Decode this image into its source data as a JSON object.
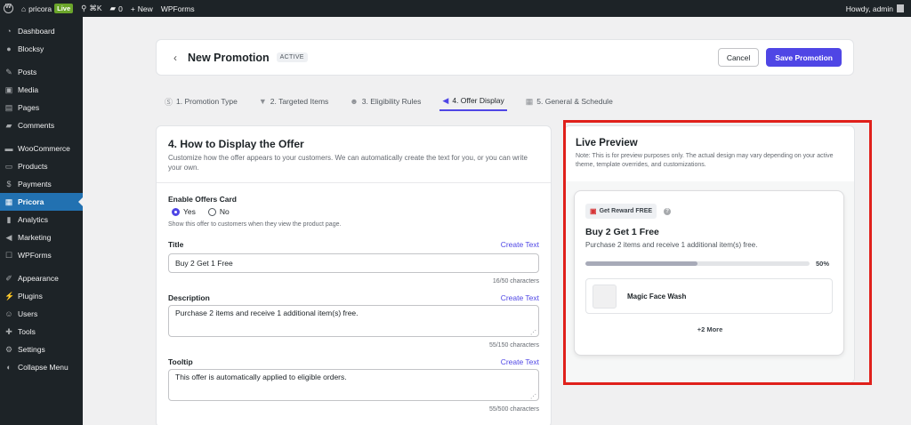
{
  "adminbar": {
    "site_name": "pricora",
    "live_label": "Live",
    "shortcut_label": "⌘K",
    "comments_count": "0",
    "new_label": "New",
    "wpforms_label": "WPForms",
    "howdy": "Howdy, admin"
  },
  "sidebar": {
    "items": [
      {
        "label": "Dashboard",
        "icon": "dashboard-icon"
      },
      {
        "label": "Blocksy",
        "icon": "blocksy-icon"
      },
      {
        "label": "Posts",
        "icon": "pin-icon"
      },
      {
        "label": "Media",
        "icon": "media-icon"
      },
      {
        "label": "Pages",
        "icon": "pages-icon"
      },
      {
        "label": "Comments",
        "icon": "comment-icon"
      },
      {
        "label": "WooCommerce",
        "icon": "woo-icon"
      },
      {
        "label": "Products",
        "icon": "products-icon"
      },
      {
        "label": "Payments",
        "icon": "payments-icon"
      },
      {
        "label": "Pricora",
        "icon": "pricora-icon"
      },
      {
        "label": "Analytics",
        "icon": "analytics-icon"
      },
      {
        "label": "Marketing",
        "icon": "megaphone-icon"
      },
      {
        "label": "WPForms",
        "icon": "forms-icon"
      },
      {
        "label": "Appearance",
        "icon": "brush-icon"
      },
      {
        "label": "Plugins",
        "icon": "plugin-icon"
      },
      {
        "label": "Users",
        "icon": "user-icon"
      },
      {
        "label": "Tools",
        "icon": "wrench-icon"
      },
      {
        "label": "Settings",
        "icon": "settings-icon"
      },
      {
        "label": "Collapse Menu",
        "icon": "collapse-icon"
      }
    ]
  },
  "header": {
    "title": "New Promotion",
    "status": "ACTIVE",
    "cancel_label": "Cancel",
    "save_label": "Save Promotion"
  },
  "tabs": [
    {
      "label": "1. Promotion Type",
      "icon": "dollar-icon"
    },
    {
      "label": "2. Targeted Items",
      "icon": "filter-icon"
    },
    {
      "label": "3. Eligibility Rules",
      "icon": "user-icon"
    },
    {
      "label": "4. Offer Display",
      "icon": "megaphone-icon"
    },
    {
      "label": "5. General & Schedule",
      "icon": "calendar-icon"
    }
  ],
  "form": {
    "title": "4. How to Display the Offer",
    "description": "Customize how the offer appears to your customers. We can automatically create the text for you, or you can write your own.",
    "enable_label": "Enable Offers Card",
    "yes_label": "Yes",
    "no_label": "No",
    "enable_hint": "Show this offer to customers when they view the product page.",
    "title_label": "Title",
    "title_value": "Buy 2 Get 1 Free",
    "title_count": "16/50 characters",
    "create_text": "Create Text",
    "description_label": "Description",
    "description_value": "Purchase 2 items and receive 1 additional item(s) free.",
    "description_count": "55/150 characters",
    "tooltip_label": "Tooltip",
    "tooltip_value": "This offer is automatically applied to eligible orders.",
    "tooltip_count": "55/500 characters"
  },
  "preview": {
    "title": "Live Preview",
    "note": "Note: This is for preview purposes only. The actual design may vary depending on your active theme, template overrides, and customizations.",
    "reward_label": "Get Reward FREE",
    "offer_title": "Buy 2 Get 1 Free",
    "offer_desc": "Purchase 2 items and receive 1 additional item(s) free.",
    "progress": 0.5,
    "progress_label": "50%",
    "product_name": "Magic Face Wash",
    "more_label": "+2 More"
  },
  "colors": {
    "accent": "#4f46e5",
    "highlight": "#e0201b",
    "sidebar_bg": "#1d2327",
    "sidebar_active": "#2271b1"
  }
}
